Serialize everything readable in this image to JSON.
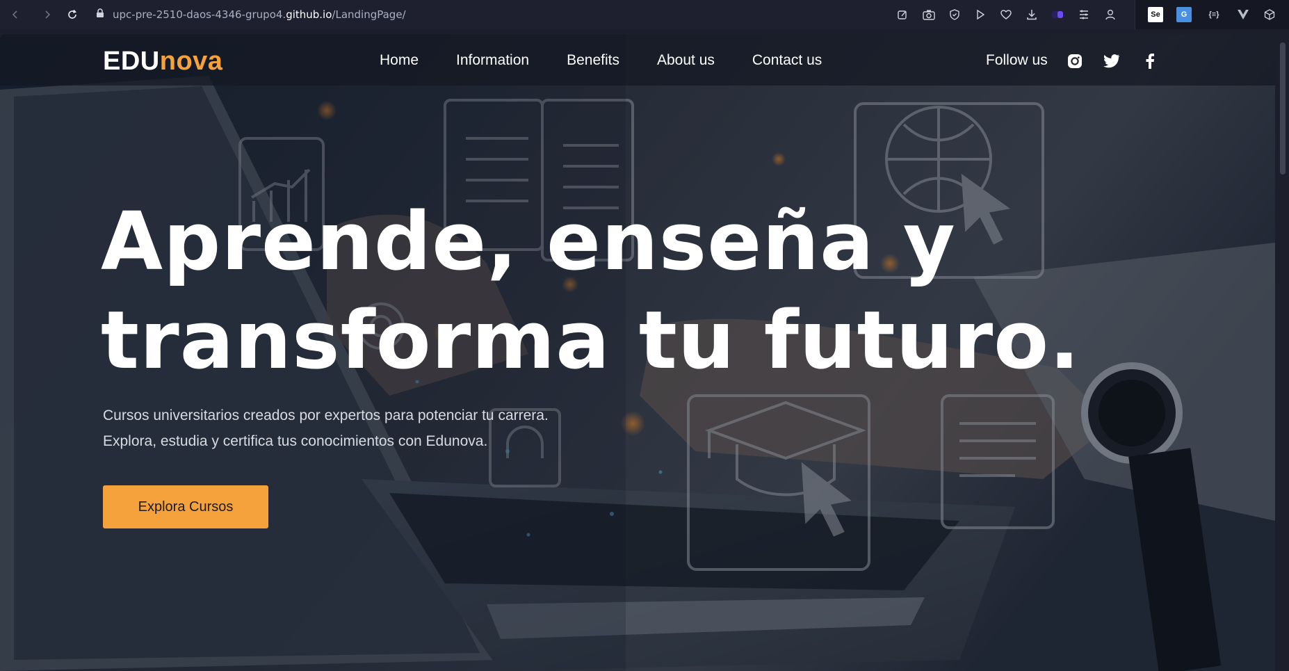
{
  "browser": {
    "url_prefix": "upc-pre-2510-daos-4346-grupo4.",
    "url_domain": "github.io",
    "url_path": "/LandingPage/",
    "icons": [
      "back-icon",
      "forward-icon",
      "reload-icon",
      "lock-icon",
      "edit-icon",
      "camera-icon",
      "shield-icon",
      "play-icon",
      "heart-icon",
      "download-icon",
      "extension-badge-icon",
      "menu-lines-icon",
      "profile-icon"
    ],
    "extensions": [
      {
        "name": "selenium-extension-icon",
        "label": "Se",
        "color": "#ffffff"
      },
      {
        "name": "translate-extension-icon",
        "label": "G",
        "color": "#4a90e2"
      },
      {
        "name": "json-extension-icon",
        "label": "{≡}",
        "color": "#cfd2dc"
      },
      {
        "name": "vue-devtools-icon",
        "label": "V",
        "color": "#cfd2dc"
      },
      {
        "name": "cube-extension-icon",
        "label": "",
        "color": "#cfd2dc"
      }
    ]
  },
  "header": {
    "logo_edu": "EDU",
    "logo_nova": "nova",
    "nav": [
      {
        "label": "Home"
      },
      {
        "label": "Information"
      },
      {
        "label": "Benefits"
      },
      {
        "label": "About us"
      },
      {
        "label": "Contact us"
      }
    ],
    "follow_label": "Follow us",
    "social": [
      "instagram-icon",
      "twitter-icon",
      "facebook-icon"
    ]
  },
  "hero": {
    "headline_line1": "Aprende, enseña y",
    "headline_line2": "transforma tu futuro.",
    "sub_line1": "Cursos universitarios creados por expertos para potenciar tu carrera.",
    "sub_line2": "Explora, estudia y certifica tus conocimientos con Edunova.",
    "cta_label": "Explora Cursos"
  },
  "colors": {
    "accent": "#f6a23c",
    "chrome_bg": "#1e2030",
    "overlay": "#141822"
  }
}
